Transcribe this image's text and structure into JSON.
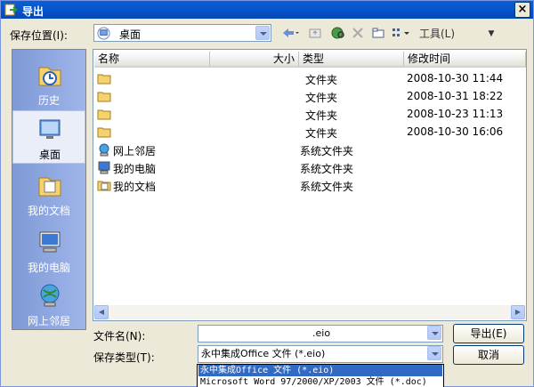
{
  "window": {
    "title": "导出",
    "close_label": "×"
  },
  "location": {
    "label": "保存位置(I):",
    "value": "桌面"
  },
  "toolbar": {
    "tools_label": "工具(L)"
  },
  "places": [
    {
      "label": "历史",
      "icon": "history-icon",
      "selected": false
    },
    {
      "label": "桌面",
      "icon": "desktop-icon",
      "selected": true
    },
    {
      "label": "我的文档",
      "icon": "my-documents-icon",
      "selected": false
    },
    {
      "label": "我的电脑",
      "icon": "my-computer-icon",
      "selected": false
    },
    {
      "label": "网上邻居",
      "icon": "network-icon",
      "selected": false
    }
  ],
  "columns": {
    "name": "名称",
    "size": "大小",
    "type": "类型",
    "modified": "修改时间"
  },
  "files": [
    {
      "name": "",
      "type": "文件夹",
      "modified": "2008-10-30 11:44",
      "icon": "folder-icon"
    },
    {
      "name": "",
      "type": "文件夹",
      "modified": "2008-10-31 18:22",
      "icon": "folder-icon"
    },
    {
      "name": "",
      "type": "文件夹",
      "modified": "2008-10-23 11:13",
      "icon": "folder-icon"
    },
    {
      "name": "",
      "type": "文件夹",
      "modified": "2008-10-30 16:06",
      "icon": "folder-icon"
    },
    {
      "name": "网上邻居",
      "type": "系统文件夹",
      "modified": "",
      "icon": "network-icon"
    },
    {
      "name": "我的电脑",
      "type": "系统文件夹",
      "modified": "",
      "icon": "my-computer-icon"
    },
    {
      "name": "我的文档",
      "type": "系统文件夹",
      "modified": "",
      "icon": "my-documents-icon"
    }
  ],
  "filename": {
    "label": "文件名(N):",
    "value": ".eio"
  },
  "filetype": {
    "label": "保存类型(T):",
    "value": "永中集成Office 文件 (*.eio)",
    "options": [
      "永中集成Office 文件 (*.eio)",
      "Microsoft Word 97/2000/XP/2003 文件 (*.doc)"
    ]
  },
  "buttons": {
    "export": "导出(E)",
    "cancel": "取消"
  }
}
